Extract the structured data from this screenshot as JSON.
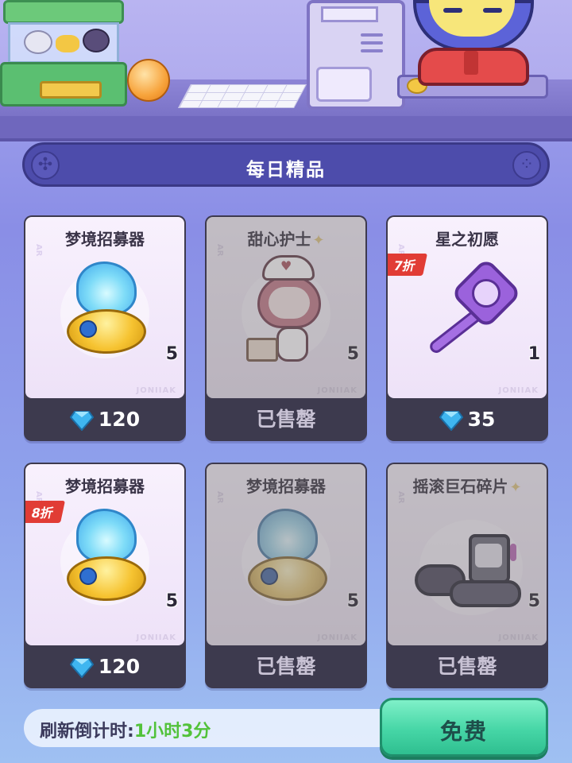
{
  "header": {
    "title": "每日精品"
  },
  "cards": [
    {
      "name": "梦境招募器",
      "qty": "5",
      "price": "120",
      "currency_icon": "gem-icon",
      "sold": false,
      "discount": ""
    },
    {
      "name": "甜心护士",
      "qty": "5",
      "price": "已售罄",
      "currency_icon": "",
      "sold": true,
      "discount": "",
      "puzzle": true
    },
    {
      "name": "星之初愿",
      "qty": "1",
      "price": "35",
      "currency_icon": "gem-icon",
      "sold": false,
      "discount": "7折"
    },
    {
      "name": "梦境招募器",
      "qty": "5",
      "price": "120",
      "currency_icon": "gem-icon",
      "sold": false,
      "discount": "8折"
    },
    {
      "name": "梦境招募器",
      "qty": "5",
      "price": "已售罄",
      "currency_icon": "",
      "sold": true,
      "discount": ""
    },
    {
      "name": "摇滚巨石碎片",
      "qty": "5",
      "price": "已售罄",
      "currency_icon": "",
      "sold": true,
      "discount": "",
      "puzzle": true
    }
  ],
  "footer": {
    "refresh_label": "刷新倒计时:",
    "refresh_time": "1小时3分",
    "free_button": "免费"
  },
  "colors": {
    "gem": "#3fb6f0",
    "discount": "#e13c35",
    "free_button": "#46d6a6",
    "countdown": "#52c23a"
  }
}
